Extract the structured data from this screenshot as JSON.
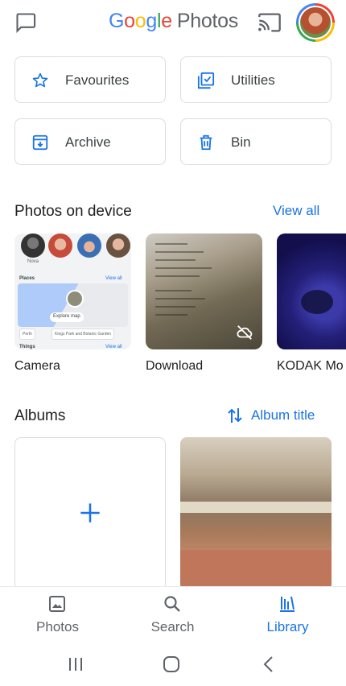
{
  "header": {
    "logo_google": [
      "G",
      "o",
      "o",
      "g",
      "l",
      "e"
    ],
    "logo_photos": "Photos",
    "icons": [
      "chat-icon",
      "cast-icon",
      "account-avatar"
    ]
  },
  "utilities": {
    "items": [
      {
        "label": "Favourites",
        "icon": "star-icon"
      },
      {
        "label": "Utilities",
        "icon": "utilities-icon"
      },
      {
        "label": "Archive",
        "icon": "archive-icon"
      },
      {
        "label": "Bin",
        "icon": "trash-icon"
      }
    ]
  },
  "device": {
    "title": "Photos on device",
    "view_all": "View all",
    "folders": [
      {
        "label": "Camera"
      },
      {
        "label": "Download"
      },
      {
        "label": "KODAK Mo"
      }
    ],
    "camera_mini": {
      "face_label": "Nova",
      "view_all": "View all",
      "places": "Places",
      "explore": "Explore map",
      "chips": [
        "Perth",
        "Kings Park and Botanic Garden"
      ],
      "things": "Things",
      "things_view_all": "View all"
    }
  },
  "albums": {
    "title": "Albums",
    "sort_label": "Album title"
  },
  "nav": {
    "items": [
      {
        "label": "Photos",
        "icon": "photo-icon"
      },
      {
        "label": "Search",
        "icon": "search-icon"
      },
      {
        "label": "Library",
        "icon": "library-icon"
      }
    ],
    "active": "Library"
  },
  "colors": {
    "accent": "#1a73e8",
    "text": "#202124",
    "border": "#dadce0"
  }
}
